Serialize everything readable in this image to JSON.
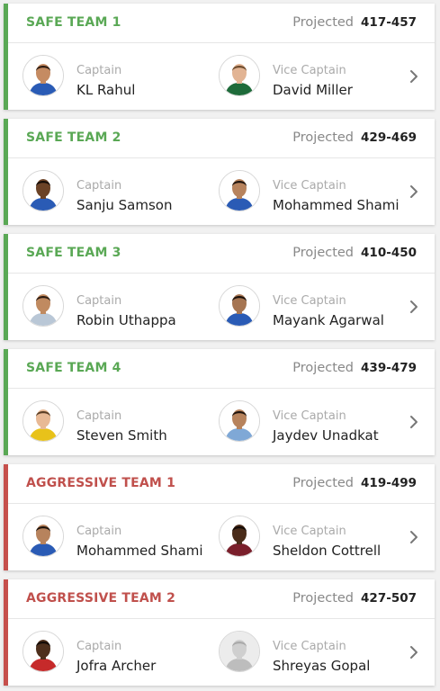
{
  "projected_label": "Projected",
  "colors": {
    "safe": "#5aa855",
    "aggressive": "#c0504c"
  },
  "teams": [
    {
      "name": "SAFE TEAM 1",
      "kind": "safe",
      "range": "417-457",
      "captain": {
        "role": "Captain",
        "name": "KL Rahul",
        "jersey": "#2a5bb5",
        "skin": "#c58b62",
        "hair": "#2b1b12"
      },
      "vice": {
        "role": "Vice Captain",
        "name": "David Miller",
        "jersey": "#1e6b3a",
        "skin": "#e2b494",
        "hair": "#6b4a2c"
      }
    },
    {
      "name": "SAFE TEAM 2",
      "kind": "safe",
      "range": "429-469",
      "captain": {
        "role": "Captain",
        "name": "Sanju Samson",
        "jersey": "#2a5bb5",
        "skin": "#6b4226",
        "hair": "#150c07"
      },
      "vice": {
        "role": "Vice Captain",
        "name": "Mohammed Shami",
        "jersey": "#2a5bb5",
        "skin": "#b7835d",
        "hair": "#1d130d"
      }
    },
    {
      "name": "SAFE TEAM 3",
      "kind": "safe",
      "range": "410-450",
      "captain": {
        "role": "Captain",
        "name": "Robin Uthappa",
        "jersey": "#b9c7d6",
        "skin": "#c08a60",
        "hair": "#2b1b12"
      },
      "vice": {
        "role": "Vice Captain",
        "name": "Mayank Agarwal",
        "jersey": "#2a5bb5",
        "skin": "#a67552",
        "hair": "#1a100a"
      }
    },
    {
      "name": "SAFE TEAM 4",
      "kind": "safe",
      "range": "439-479",
      "captain": {
        "role": "Captain",
        "name": "Steven Smith",
        "jersey": "#e8c21a",
        "skin": "#e8b995",
        "hair": "#5a3e25"
      },
      "vice": {
        "role": "Vice Captain",
        "name": "Jaydev Unadkat",
        "jersey": "#7fa8d6",
        "skin": "#b7835d",
        "hair": "#1d130d"
      }
    },
    {
      "name": "AGGRESSIVE TEAM 1",
      "kind": "aggressive",
      "range": "419-499",
      "captain": {
        "role": "Captain",
        "name": "Mohammed Shami",
        "jersey": "#2a5bb5",
        "skin": "#b7835d",
        "hair": "#1d130d"
      },
      "vice": {
        "role": "Vice Captain",
        "name": "Sheldon Cottrell",
        "jersey": "#7a1f2b",
        "skin": "#4a2c1a",
        "hair": "#120a06"
      }
    },
    {
      "name": "AGGRESSIVE TEAM 2",
      "kind": "aggressive",
      "range": "427-507",
      "captain": {
        "role": "Captain",
        "name": "Jofra Archer",
        "jersey": "#c62a2a",
        "skin": "#4e2f1c",
        "hair": "#120a06"
      },
      "vice": {
        "role": "Vice Captain",
        "name": "Shreyas Gopal",
        "jersey": "#bdbdbd",
        "skin": "#cfcfcf",
        "hair": "#a8a8a8",
        "placeholder": true
      }
    }
  ]
}
